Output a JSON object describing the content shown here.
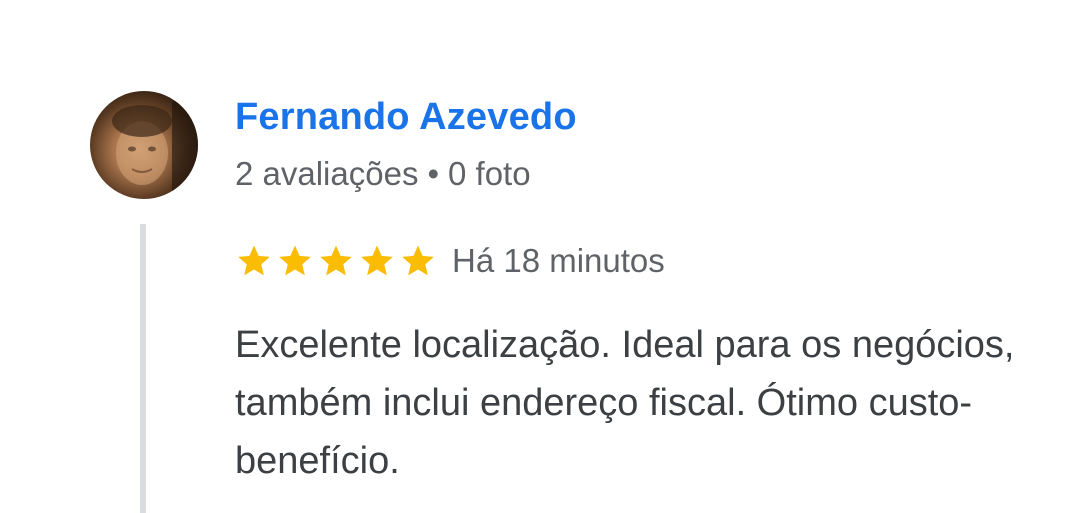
{
  "author": {
    "name": "Fernando Azevedo",
    "reviews_count": "2 avaliações",
    "separator": "•",
    "photos_count": "0 foto"
  },
  "review": {
    "rating": 5,
    "rating_max": 5,
    "time": "Há 18 minutos",
    "text": "Excelente localização. Ideal para os negócios, também inclui endereço fiscal. Ótimo custo-benefício."
  },
  "colors": {
    "author_link": "#1a73e8",
    "star": "#fbbc04",
    "meta_text": "#5f6368",
    "body_text": "#3c4043",
    "thread_line": "#dadce0"
  },
  "icons": {
    "star": "star-icon",
    "avatar": "user-photo"
  }
}
